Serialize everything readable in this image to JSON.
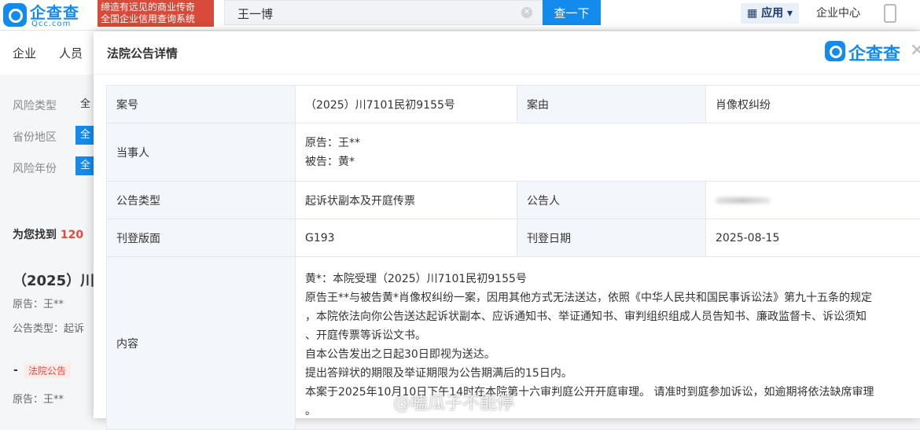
{
  "topbar": {
    "logo_cn": "企查查",
    "logo_en": "Qcc.com",
    "slogan_line1": "缔造有远见的商业传奇",
    "slogan_line2": "全国企业信用查询系统",
    "search_value": "王一博",
    "search_button": "查一下",
    "apps_label": "应用",
    "enterprise_center": "企业中心"
  },
  "tabs": [
    "企业",
    "人员"
  ],
  "filters": [
    {
      "label": "风险类型",
      "value": "全"
    },
    {
      "label": "省份地区",
      "value": "全"
    },
    {
      "label": "风险年份",
      "value": "全"
    }
  ],
  "results": {
    "found_prefix": "为您找到",
    "found_count": "120",
    "case_title": "（2025）川",
    "case_plaintiff": "原告：王**",
    "case_type": "公告类型：起诉",
    "tag": "法院公告",
    "case2_plaintiff": "原告：王**"
  },
  "modal": {
    "title": "法院公告详情",
    "brand": "企查查",
    "rows": {
      "case_no_label": "案号",
      "case_no": "（2025）川7101民初9155号",
      "cause_label": "案由",
      "cause": "肖像权纠纷",
      "parties_label": "当事人",
      "plaintiff": "原告：王**",
      "defendant": "被告：黄*",
      "notice_type_label": "公告类型",
      "notice_type": "起诉状副本及开庭传票",
      "announcer_label": "公告人",
      "page_label": "刊登版面",
      "page": "G193",
      "date_label": "刊登日期",
      "date": "2025-08-15",
      "content_label": "内容",
      "content_lines": [
        "黄*：本院受理（2025）川7101民初9155号",
        "原告王**与被告黄*肖像权纠纷一案，因用其他方式无法送达，依照《中华人民共和国民事诉讼法》第九十五条的规定",
        "，本院依法向你公告送达起诉状副本、应诉通知书、举证通知书、审判组织组成人员告知书、廉政监督卡、诉讼须知",
        "、开庭传票等诉讼文书。",
        "自本公告发出之日起30日即视为送达。",
        "提出答辩状的期限及举证期限为公告期满后的15日内。",
        "本案于2025年10月10日下午14时在本院第十六审判庭公开开庭审理。 请准时到庭参加诉讼，如逾期将依法缺席审理",
        "。"
      ]
    }
  },
  "watermark": "@嗑瓜子不能停"
}
